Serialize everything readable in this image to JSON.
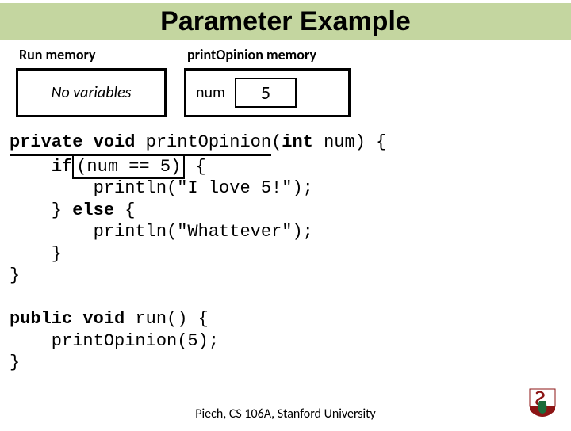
{
  "title": "Parameter Example",
  "memory": {
    "run": {
      "header": "Run memory",
      "text": "No variables"
    },
    "printOpinion": {
      "header": "printOpinion memory",
      "var_label": "num",
      "var_value": "5"
    }
  },
  "code": {
    "sig_private": "private",
    "sig_void": "void",
    "sig_fn": "printOpinion",
    "sig_paren_open": "(",
    "sig_int": "int",
    "sig_param": " num) {",
    "if_kw": "if",
    "if_cond": "(num == 5)",
    "if_tail": " {",
    "line_love": "        println(\"I love 5!\");",
    "else_pre": "    } ",
    "else_kw": "else",
    "else_tail": " {",
    "line_what": "        println(\"Whattever\");",
    "brace_inner": "    }",
    "brace_outer": "}",
    "run_public": "public",
    "run_void": "void",
    "run_fn": "run() {",
    "run_call": "    printOpinion(5);",
    "run_close": "}"
  },
  "footer": "Piech, CS 106A, Stanford University"
}
